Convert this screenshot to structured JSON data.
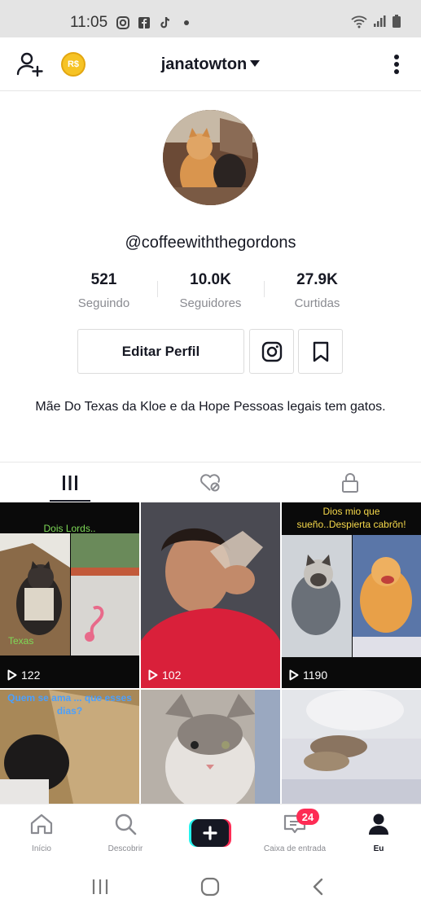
{
  "status_bar": {
    "time": "11:05",
    "icons": [
      "instagram-icon",
      "facebook-icon",
      "tiktok-icon",
      "dot-icon",
      "wifi-icon",
      "signal-icon",
      "battery-icon"
    ]
  },
  "header": {
    "coin_label": "R$",
    "title": "janatowton"
  },
  "profile": {
    "username": "@coffeewiththegordons",
    "stats": [
      {
        "value": "521",
        "label": "Seguindo"
      },
      {
        "value": "10.0K",
        "label": "Seguidores"
      },
      {
        "value": "27.9K",
        "label": "Curtidas"
      }
    ],
    "edit_button": "Editar Perfil",
    "bio": "Mãe Do Texas da Kloe e da Hope Pessoas legais tem gatos."
  },
  "tabs": [
    "videos-grid-icon",
    "liked-hidden-icon",
    "private-lock-icon"
  ],
  "videos": [
    {
      "caption": "Dois Lords..",
      "overlay": "Texas",
      "views": "122"
    },
    {
      "caption": "",
      "overlay": "",
      "views": "102"
    },
    {
      "caption": "Dios mio que sueño..Despierta cabrõn!",
      "overlay": "",
      "views": "1190"
    },
    {
      "caption": "Quem se ama ... que esses dias?",
      "overlay": "",
      "views": ""
    },
    {
      "caption": "",
      "overlay": "",
      "views": ""
    },
    {
      "caption": "",
      "overlay": "",
      "views": ""
    }
  ],
  "bottom_nav": {
    "items": [
      {
        "label": "Início",
        "icon": "home-icon"
      },
      {
        "label": "Descobrir",
        "icon": "search-icon"
      },
      {
        "label": "",
        "icon": "create-plus-icon"
      },
      {
        "label": "Caixa de entrada",
        "icon": "inbox-icon"
      },
      {
        "label": "Eu",
        "icon": "profile-icon"
      }
    ],
    "inbox_badge": "24"
  },
  "colors": {
    "accent": "#fe2c55",
    "text": "#161823",
    "muted": "#8a8b91",
    "coin": "#f6c325"
  }
}
